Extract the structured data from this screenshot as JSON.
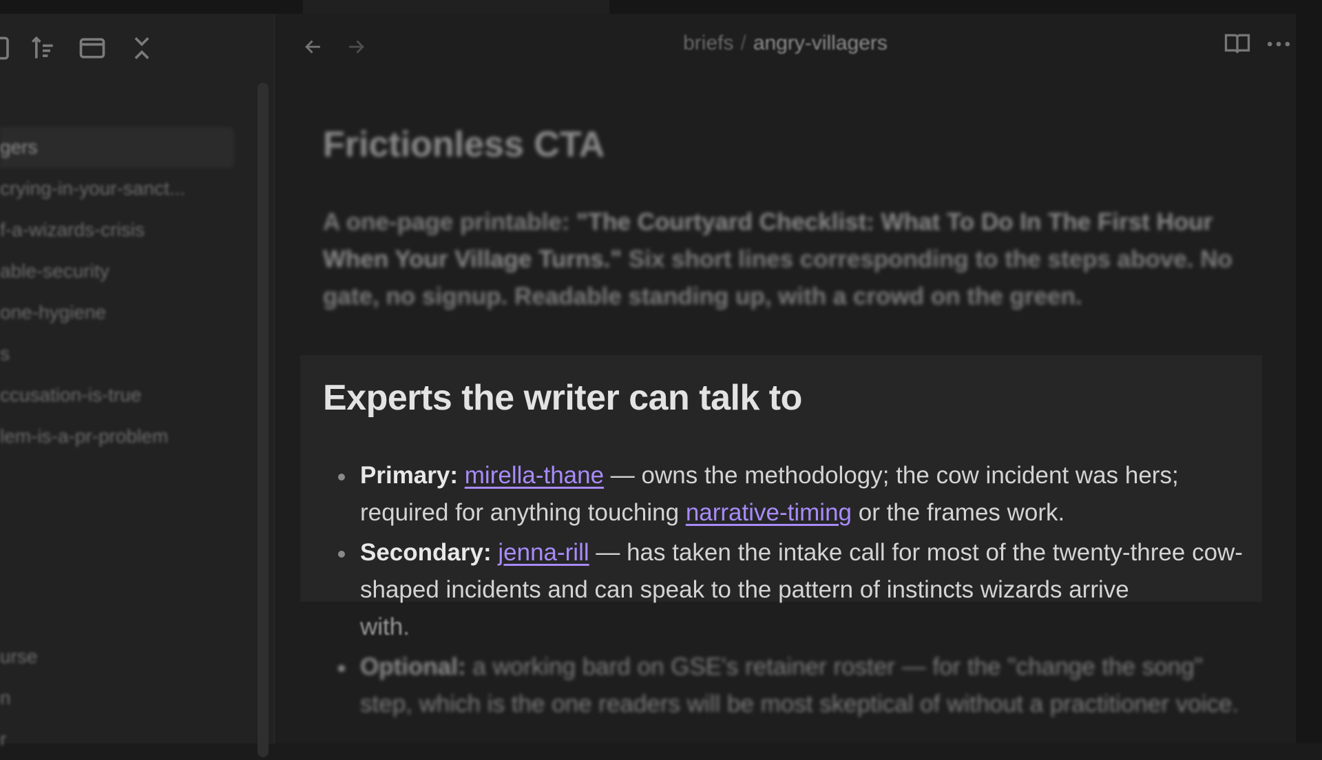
{
  "sidebar": {
    "toolbar_icons": [
      "new-note-icon",
      "sort-icon",
      "collapse-view-icon",
      "collapse-all-icon"
    ],
    "files_top": [
      {
        "label": "gers",
        "active": true
      },
      {
        "label": "crying-in-your-sanct...",
        "active": false
      },
      {
        "label": "f-a-wizards-crisis",
        "active": false
      },
      {
        "label": "able-security",
        "active": false
      },
      {
        "label": "one-hygiene",
        "active": false
      },
      {
        "label": "s",
        "active": false
      },
      {
        "label": "ccusation-is-true",
        "active": false
      },
      {
        "label": "lem-is-a-pr-problem",
        "active": false
      }
    ],
    "files_bottom": [
      {
        "label": "urse"
      },
      {
        "label": "n"
      },
      {
        "label": "r"
      }
    ]
  },
  "header": {
    "back_icon": "arrow-left-icon",
    "forward_icon": "arrow-right-icon",
    "breadcrumb_folder": "briefs",
    "breadcrumb_sep": "/",
    "breadcrumb_file": "angry-villagers",
    "reading_view_icon": "book-open-icon",
    "more_icon": "more-horizontal-icon"
  },
  "document": {
    "h1": "Frictionless CTA",
    "para_lead": "A one-page printable: ",
    "para_bold": "\"The Courtyard Checklist: What To Do In The First Hour When Your Village Turns.\"",
    "para_tail": " Six short lines corresponding to the steps above. No gate, no signup. Readable standing up, with a crowd on the green.",
    "h2": "Experts the writer can talk to",
    "experts": {
      "primary_label": "Primary:",
      "primary_link": "mirella-thane",
      "primary_text_1": " — owns the methodology; the cow incident was hers; required for anything touching ",
      "primary_link_2": "narrative-timing",
      "primary_text_2": " or the frames work.",
      "secondary_label": "Secondary:",
      "secondary_link": "jenna-rill",
      "secondary_text": " — has taken the intake call for most of the twenty-three cow-shaped incidents and can speak to the pattern of instincts wizards arrive",
      "secondary_tail": "with.",
      "optional_label": "Optional:",
      "optional_text": " a working bard on GSE's retainer roster — for the \"change the song\" step, which is the one readers will be most skeptical of without a practitioner voice."
    }
  },
  "colors": {
    "link": "#a88bfa",
    "background": "#1e1e1e",
    "focused_block": "#262626"
  }
}
